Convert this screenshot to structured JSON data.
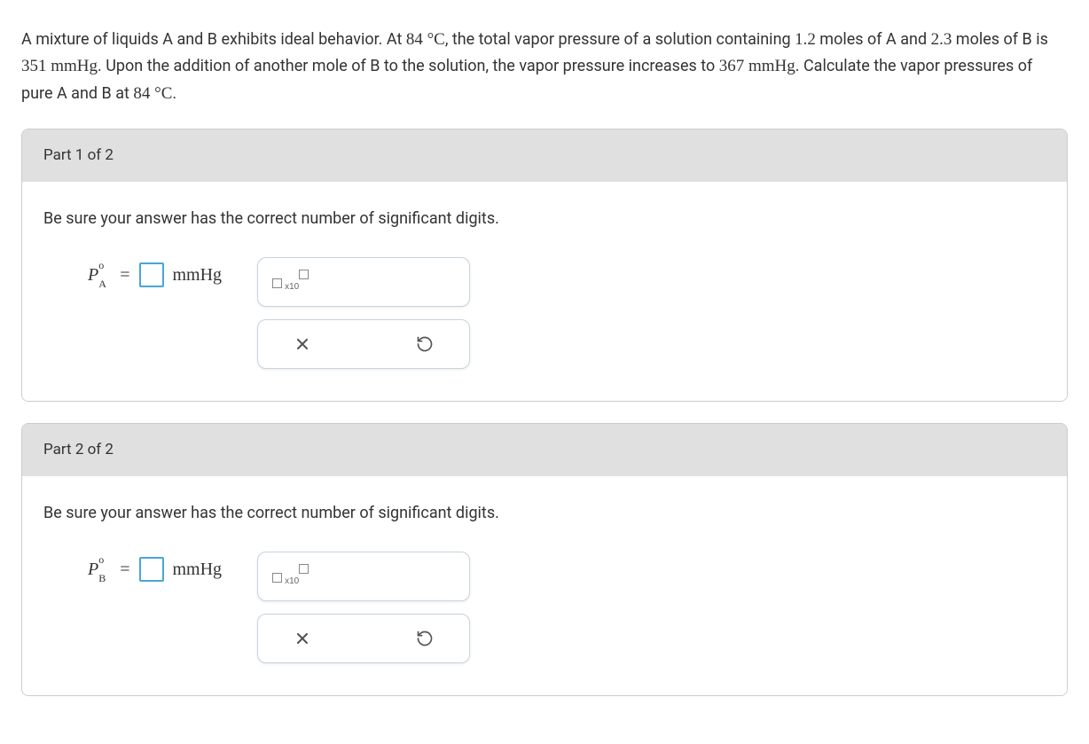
{
  "question": {
    "part1": "A mixture of liquids A and B exhibits ideal behavior. At ",
    "temp1": "84 °C",
    "part2": ", the total vapor pressure of a solution containing ",
    "molesA": "1.2",
    "part3": " moles of A and ",
    "molesB": "2.3",
    "part4": " moles of B is ",
    "pressure1": "351 mmHg",
    "part5": ". Upon the addition of another mole of B to the solution, the vapor pressure increases to ",
    "pressure2": "367 mmHg",
    "part6": ". Calculate the vapor pressures of pure A and B at ",
    "temp2": "84 °C",
    "part7": "."
  },
  "parts": [
    {
      "header": "Part 1 of 2",
      "instruction": "Be sure your answer has the correct number of significant digits.",
      "variable_base": "P",
      "variable_sup": "o",
      "variable_sub": "A",
      "equals": "=",
      "unit": "mmHg",
      "sci_x10": "x10"
    },
    {
      "header": "Part 2 of 2",
      "instruction": "Be sure your answer has the correct number of significant digits.",
      "variable_base": "P",
      "variable_sup": "o",
      "variable_sub": "B",
      "equals": "=",
      "unit": "mmHg",
      "sci_x10": "x10"
    }
  ]
}
